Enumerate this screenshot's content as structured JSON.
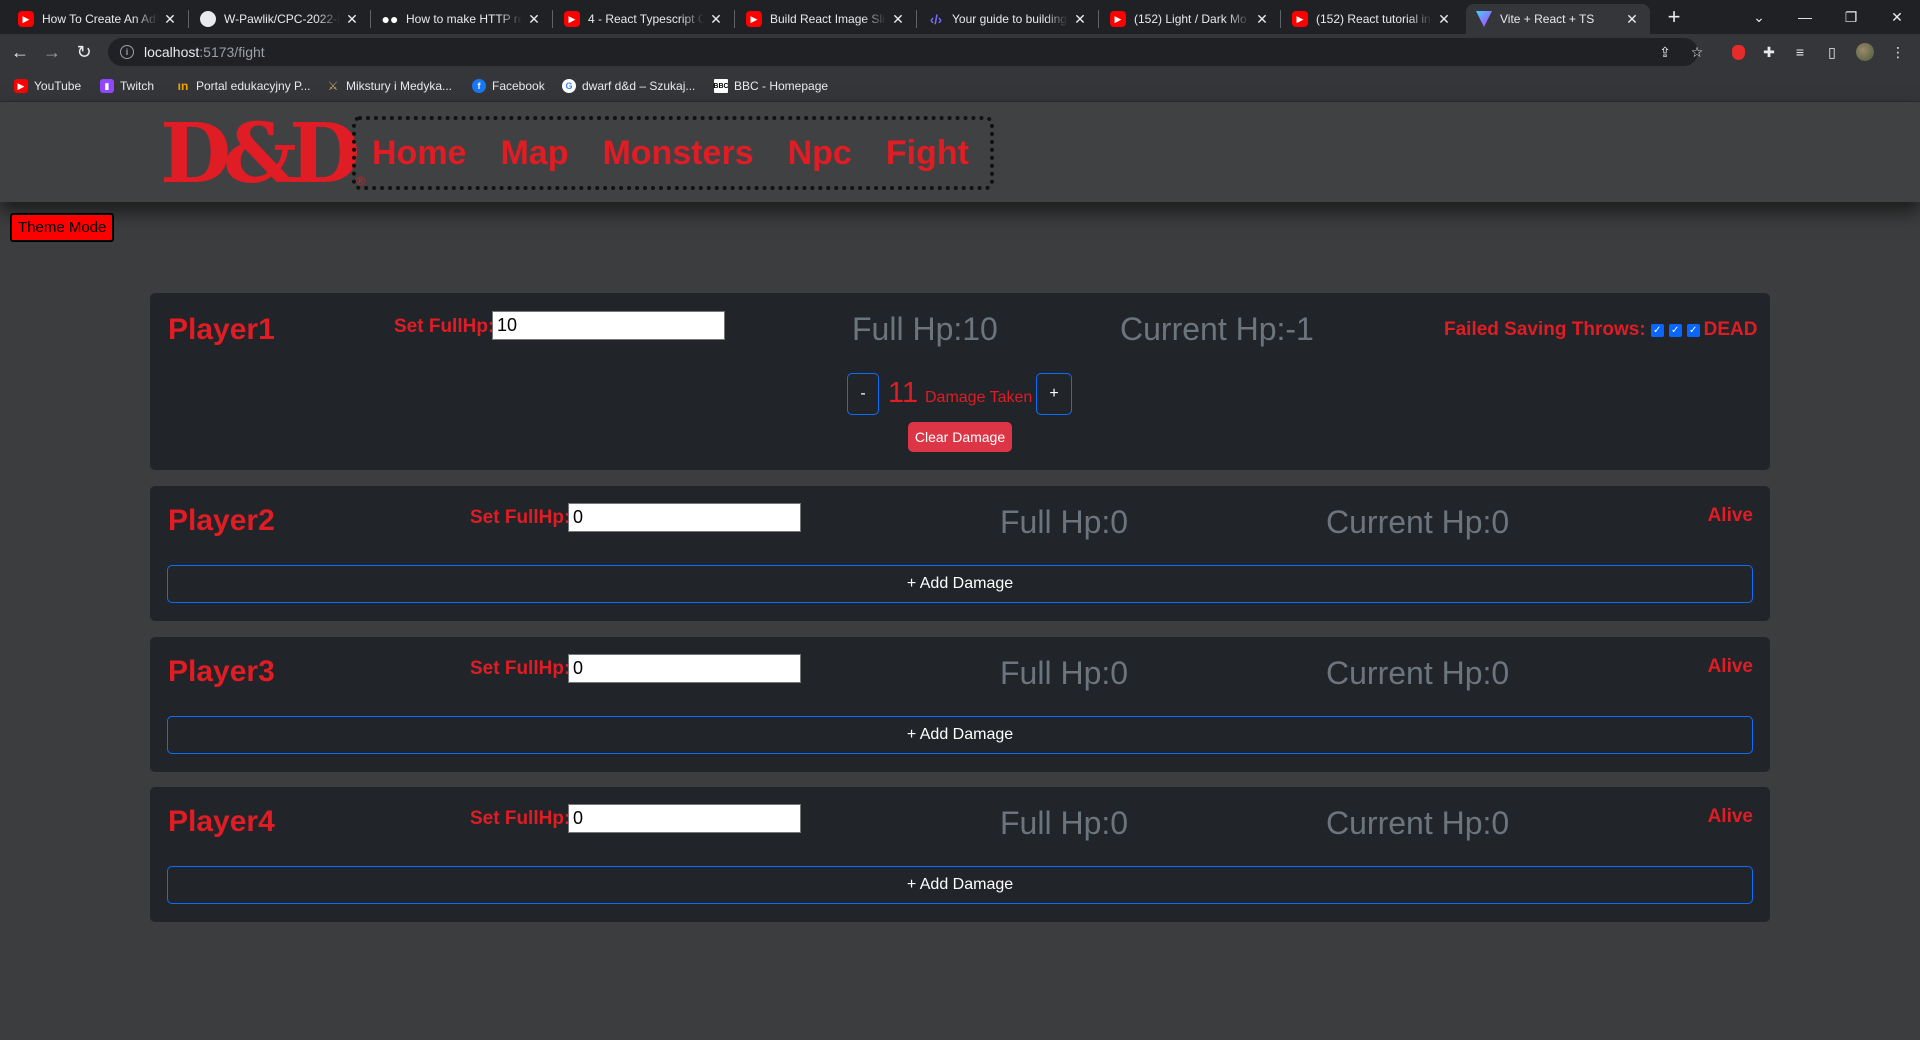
{
  "browser": {
    "tabs": [
      {
        "title": "How To Create An Adv",
        "icon": "youtube-icon"
      },
      {
        "title": "W-Pawlik/CPC-2022-P",
        "icon": "github-icon"
      },
      {
        "title": "How to make HTTP re",
        "icon": "medium-icon"
      },
      {
        "title": "4 - React Typescript Cr",
        "icon": "youtube-icon"
      },
      {
        "title": "Build React Image Slid",
        "icon": "youtube-icon"
      },
      {
        "title": "Your guide to building",
        "icon": "dev-icon"
      },
      {
        "title": "(152) Light / Dark Mo",
        "icon": "youtube-icon"
      },
      {
        "title": "(152) React tutorial in",
        "icon": "youtube-icon"
      },
      {
        "title": "Vite + React + TS",
        "icon": "vite-icon",
        "active": true
      }
    ],
    "address": {
      "host": "localhost",
      "path": ":5173/fight"
    },
    "bookmarks": [
      {
        "label": "YouTube",
        "icon": "youtube-icon"
      },
      {
        "label": "Twitch",
        "icon": "twitch-icon"
      },
      {
        "label": "Portal edukacyjny P...",
        "icon": "portal-icon"
      },
      {
        "label": "Mikstury i Medyka...",
        "icon": "mikstury-icon"
      },
      {
        "label": "Facebook",
        "icon": "facebook-icon"
      },
      {
        "label": "dwarf d&d – Szukaj...",
        "icon": "google-icon"
      },
      {
        "label": "BBC - Homepage",
        "icon": "bbc-icon"
      }
    ]
  },
  "app": {
    "logo": {
      "text": "D&D",
      "reg": "®"
    },
    "nav": [
      "Home",
      "Map",
      "Monsters",
      "Npc",
      "Fight"
    ],
    "theme_button": "Theme Mode",
    "accent_color": "#e01c24",
    "players": [
      {
        "name": "Player1",
        "set_label": "Set FullHp:",
        "full_hp_value": "10",
        "full_hp": "Full Hp:10",
        "current_hp": "Current Hp:-1",
        "status": "Failed Saving Throws:",
        "checked_throws": 3,
        "status_word": "DEAD",
        "damage": {
          "minus": "-",
          "value": "11",
          "label": "Damage Taken",
          "plus": "+",
          "clear": "Clear Damage"
        }
      },
      {
        "name": "Player2",
        "set_label": "Set FullHp:",
        "full_hp_value": "0",
        "full_hp": "Full Hp:0",
        "current_hp": "Current Hp:0",
        "status": "Alive",
        "add_damage": "+ Add Damage"
      },
      {
        "name": "Player3",
        "set_label": "Set FullHp:",
        "full_hp_value": "0",
        "full_hp": "Full Hp:0",
        "current_hp": "Current Hp:0",
        "status": "Alive",
        "add_damage": "+ Add Damage"
      },
      {
        "name": "Player4",
        "set_label": "Set FullHp:",
        "full_hp_value": "0",
        "full_hp": "Full Hp:0",
        "current_hp": "Current Hp:0",
        "status": "Alive",
        "add_damage": "+ Add Damage"
      }
    ]
  }
}
